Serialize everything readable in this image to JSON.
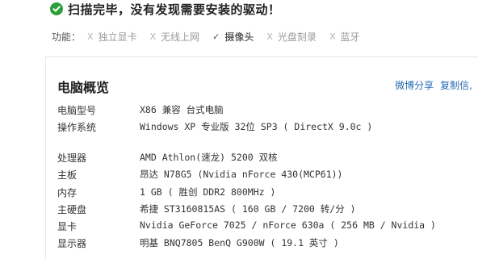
{
  "scan": {
    "status_text": "扫描完毕，没有发现需要安装的驱动！",
    "status_icon": "check-circle-icon",
    "status_color": "#2e9e3a"
  },
  "functions": {
    "label": "功能：",
    "items": [
      {
        "mark": "X",
        "label": "独立显卡",
        "state": "off"
      },
      {
        "mark": "X",
        "label": "无线上网",
        "state": "off"
      },
      {
        "mark": "✓",
        "label": "摄像头",
        "state": "on"
      },
      {
        "mark": "X",
        "label": "光盘刻录",
        "state": "off"
      },
      {
        "mark": "X",
        "label": "蓝牙",
        "state": "off"
      }
    ]
  },
  "overview": {
    "title": "电脑概览",
    "share_weibo": "微博分享",
    "copy_info": "复制信,",
    "link_color": "#2a6db3",
    "rows": [
      {
        "key": "电脑型号",
        "value": "X86 兼容 台式电脑"
      },
      {
        "key": "操作系统",
        "value": "Windows XP 专业版 32位 SP3 ( DirectX 9.0c )"
      },
      {
        "key": "处理器",
        "value": "AMD Athlon(速龙) 5200 双核"
      },
      {
        "key": "主板",
        "value": "昂达 N78G5 (Nvidia nForce 430(MCP61))"
      },
      {
        "key": "内存",
        "value": "1 GB ( 胜创 DDR2 800MHz )"
      },
      {
        "key": "主硬盘",
        "value": "希捷 ST3160815AS ( 160 GB / 7200 转/分 )"
      },
      {
        "key": "显卡",
        "value": "Nvidia GeForce 7025 / nForce 630a ( 256 MB / Nvidia )"
      },
      {
        "key": "显示器",
        "value": "明基 BNQ7805 BenQ G900W ( 19.1 英寸 )"
      }
    ]
  }
}
